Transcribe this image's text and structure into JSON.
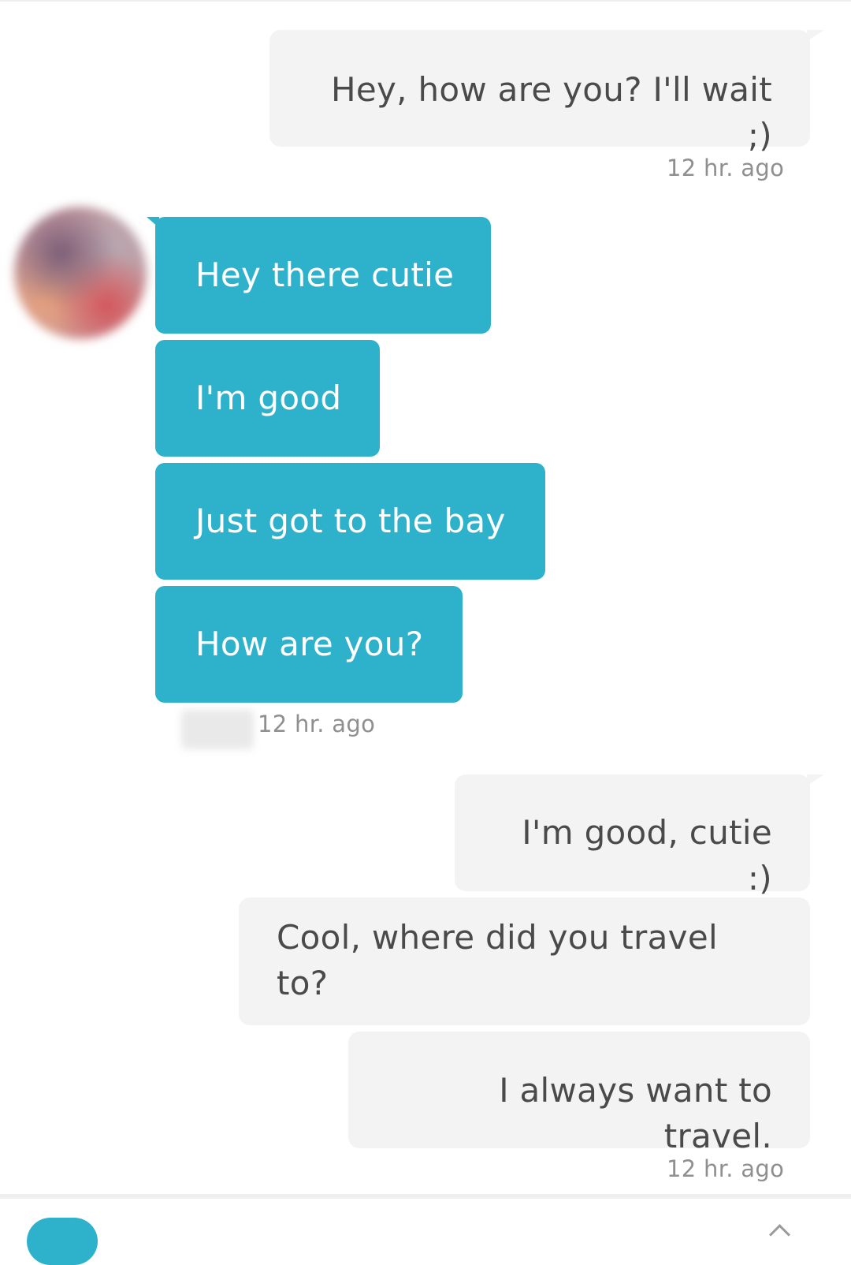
{
  "colors": {
    "incoming_bubble": "#2eb2cb",
    "outgoing_bubble": "#f3f3f3",
    "outgoing_text": "#4a4a4a",
    "incoming_text": "#ffffff",
    "timestamp": "#8f8f8f"
  },
  "conversation": {
    "group1": {
      "messages": [
        "Hey, how are you? I'll wait ;)"
      ],
      "timestamp": "12 hr. ago"
    },
    "group2": {
      "messages": [
        "Hey there cutie",
        "I'm good",
        "Just got to the bay",
        "How are you?"
      ],
      "timestamp": "12 hr. ago"
    },
    "group3": {
      "messages": [
        "I'm good, cutie :)",
        "Cool, where did you travel to?",
        "I always want to travel."
      ],
      "timestamp": "12 hr. ago"
    }
  },
  "icons": {
    "avatar": "blurred-avatar",
    "name": "blurred-name",
    "compose": "compose-icon",
    "send": "chevron-up-icon"
  }
}
